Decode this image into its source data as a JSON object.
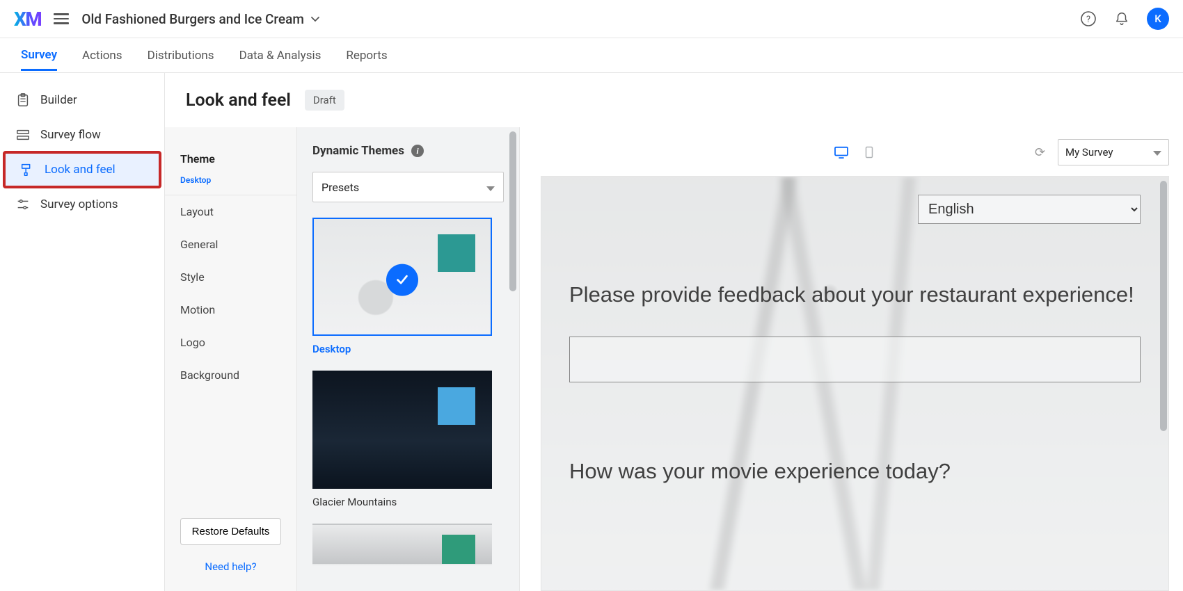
{
  "brand": "XM",
  "project_name": "Old Fashioned Burgers and Ice Cream",
  "avatar_initial": "K",
  "tabs": {
    "survey": "Survey",
    "actions": "Actions",
    "distributions": "Distributions",
    "data": "Data & Analysis",
    "reports": "Reports"
  },
  "sidebar": {
    "builder": "Builder",
    "flow": "Survey flow",
    "look": "Look and feel",
    "options": "Survey options"
  },
  "panel": {
    "title": "Look and feel",
    "badge": "Draft"
  },
  "categories": {
    "theme_title": "Theme",
    "theme_sub": "Desktop",
    "layout": "Layout",
    "general": "General",
    "style": "Style",
    "motion": "Motion",
    "logo": "Logo",
    "background": "Background",
    "restore": "Restore Defaults",
    "help": "Need help?"
  },
  "themes": {
    "heading": "Dynamic Themes",
    "dropdown": "Presets",
    "cards": [
      {
        "label": "Desktop",
        "swatch": "#2c9993",
        "selected": true
      },
      {
        "label": "Glacier Mountains",
        "swatch": "#4aa8e0",
        "selected": false
      },
      {
        "label": "",
        "swatch": "#2f9b7a",
        "selected": false
      }
    ]
  },
  "preview": {
    "survey_dropdown": "My Survey",
    "language": "English",
    "q1": "Please provide feedback about your restaurant experience!",
    "q2": "How was your movie experience today?"
  }
}
